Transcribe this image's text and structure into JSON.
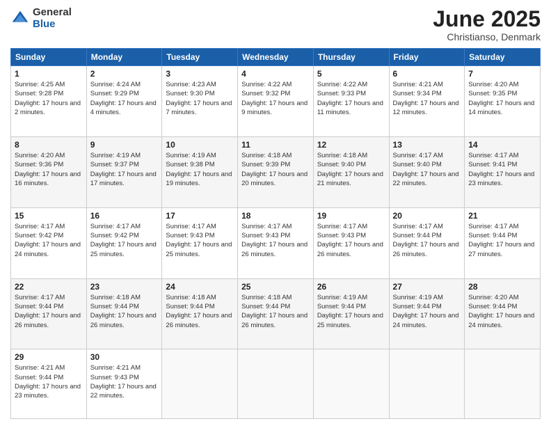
{
  "logo": {
    "general": "General",
    "blue": "Blue"
  },
  "title": {
    "month_year": "June 2025",
    "location": "Christianso, Denmark"
  },
  "weekdays": [
    "Sunday",
    "Monday",
    "Tuesday",
    "Wednesday",
    "Thursday",
    "Friday",
    "Saturday"
  ],
  "weeks": [
    [
      {
        "day": "1",
        "sunrise": "4:25 AM",
        "sunset": "9:28 PM",
        "daylight": "17 hours and 2 minutes."
      },
      {
        "day": "2",
        "sunrise": "4:24 AM",
        "sunset": "9:29 PM",
        "daylight": "17 hours and 4 minutes."
      },
      {
        "day": "3",
        "sunrise": "4:23 AM",
        "sunset": "9:30 PM",
        "daylight": "17 hours and 7 minutes."
      },
      {
        "day": "4",
        "sunrise": "4:22 AM",
        "sunset": "9:32 PM",
        "daylight": "17 hours and 9 minutes."
      },
      {
        "day": "5",
        "sunrise": "4:22 AM",
        "sunset": "9:33 PM",
        "daylight": "17 hours and 11 minutes."
      },
      {
        "day": "6",
        "sunrise": "4:21 AM",
        "sunset": "9:34 PM",
        "daylight": "17 hours and 12 minutes."
      },
      {
        "day": "7",
        "sunrise": "4:20 AM",
        "sunset": "9:35 PM",
        "daylight": "17 hours and 14 minutes."
      }
    ],
    [
      {
        "day": "8",
        "sunrise": "4:20 AM",
        "sunset": "9:36 PM",
        "daylight": "17 hours and 16 minutes."
      },
      {
        "day": "9",
        "sunrise": "4:19 AM",
        "sunset": "9:37 PM",
        "daylight": "17 hours and 17 minutes."
      },
      {
        "day": "10",
        "sunrise": "4:19 AM",
        "sunset": "9:38 PM",
        "daylight": "17 hours and 19 minutes."
      },
      {
        "day": "11",
        "sunrise": "4:18 AM",
        "sunset": "9:39 PM",
        "daylight": "17 hours and 20 minutes."
      },
      {
        "day": "12",
        "sunrise": "4:18 AM",
        "sunset": "9:40 PM",
        "daylight": "17 hours and 21 minutes."
      },
      {
        "day": "13",
        "sunrise": "4:17 AM",
        "sunset": "9:40 PM",
        "daylight": "17 hours and 22 minutes."
      },
      {
        "day": "14",
        "sunrise": "4:17 AM",
        "sunset": "9:41 PM",
        "daylight": "17 hours and 23 minutes."
      }
    ],
    [
      {
        "day": "15",
        "sunrise": "4:17 AM",
        "sunset": "9:42 PM",
        "daylight": "17 hours and 24 minutes."
      },
      {
        "day": "16",
        "sunrise": "4:17 AM",
        "sunset": "9:42 PM",
        "daylight": "17 hours and 25 minutes."
      },
      {
        "day": "17",
        "sunrise": "4:17 AM",
        "sunset": "9:43 PM",
        "daylight": "17 hours and 25 minutes."
      },
      {
        "day": "18",
        "sunrise": "4:17 AM",
        "sunset": "9:43 PM",
        "daylight": "17 hours and 26 minutes."
      },
      {
        "day": "19",
        "sunrise": "4:17 AM",
        "sunset": "9:43 PM",
        "daylight": "17 hours and 26 minutes."
      },
      {
        "day": "20",
        "sunrise": "4:17 AM",
        "sunset": "9:44 PM",
        "daylight": "17 hours and 26 minutes."
      },
      {
        "day": "21",
        "sunrise": "4:17 AM",
        "sunset": "9:44 PM",
        "daylight": "17 hours and 27 minutes."
      }
    ],
    [
      {
        "day": "22",
        "sunrise": "4:17 AM",
        "sunset": "9:44 PM",
        "daylight": "17 hours and 26 minutes."
      },
      {
        "day": "23",
        "sunrise": "4:18 AM",
        "sunset": "9:44 PM",
        "daylight": "17 hours and 26 minutes."
      },
      {
        "day": "24",
        "sunrise": "4:18 AM",
        "sunset": "9:44 PM",
        "daylight": "17 hours and 26 minutes."
      },
      {
        "day": "25",
        "sunrise": "4:18 AM",
        "sunset": "9:44 PM",
        "daylight": "17 hours and 26 minutes."
      },
      {
        "day": "26",
        "sunrise": "4:19 AM",
        "sunset": "9:44 PM",
        "daylight": "17 hours and 25 minutes."
      },
      {
        "day": "27",
        "sunrise": "4:19 AM",
        "sunset": "9:44 PM",
        "daylight": "17 hours and 24 minutes."
      },
      {
        "day": "28",
        "sunrise": "4:20 AM",
        "sunset": "9:44 PM",
        "daylight": "17 hours and 24 minutes."
      }
    ],
    [
      {
        "day": "29",
        "sunrise": "4:21 AM",
        "sunset": "9:44 PM",
        "daylight": "17 hours and 23 minutes."
      },
      {
        "day": "30",
        "sunrise": "4:21 AM",
        "sunset": "9:43 PM",
        "daylight": "17 hours and 22 minutes."
      },
      null,
      null,
      null,
      null,
      null
    ]
  ]
}
